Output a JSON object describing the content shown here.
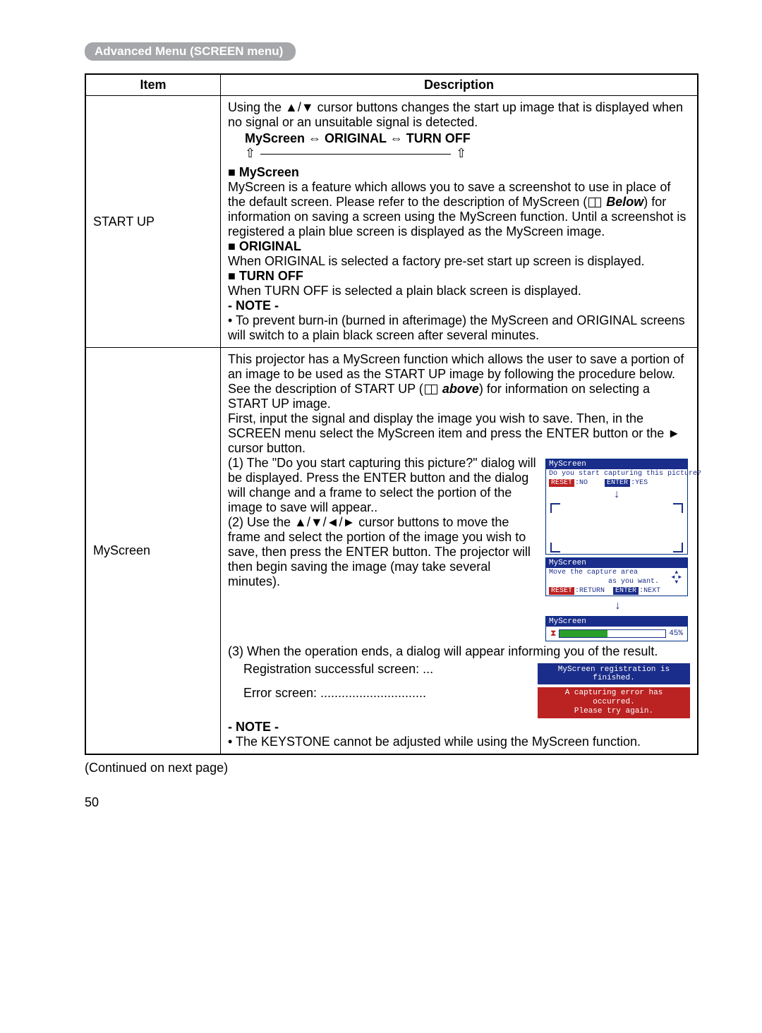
{
  "section_header": "Advanced Menu (SCREEN menu)",
  "table": {
    "header_item": "Item",
    "header_desc": "Description",
    "startup": {
      "item_label": "START UP",
      "intro": "Using the ▲/▼ cursor buttons changes the start up image that is displayed when no signal or an unsuitable signal is detected.",
      "cycle_text": "MyScreen ⇔ ORIGINAL ⇔ TURN OFF",
      "cycle_arrows_left": "⇧",
      "cycle_arrows_right": "⇧",
      "myscreen_head": "MyScreen",
      "myscreen_body_1": "MyScreen is a feature which allows you to save a screenshot to use in place of the default screen. Please refer to the description of MyScreen (",
      "below_ref": "Below",
      "myscreen_body_2": ") for information on saving a screen using the MyScreen function. Until a screenshot is registered a plain blue screen is displayed as the MyScreen image.",
      "original_head": "ORIGINAL",
      "original_body": "When ORIGINAL is selected a factory pre-set start up screen is displayed.",
      "turnoff_head": "TURN OFF",
      "turnoff_body": "When TURN OFF is selected a plain black screen is displayed.",
      "note_head": "- NOTE -",
      "note_body": "• To prevent burn-in (burned in afterimage) the MyScreen and ORIGINAL screens will switch to a plain black screen after several minutes."
    },
    "myscreen": {
      "item_label": "MyScreen",
      "intro_1": "This projector has a MyScreen function which allows the user to save a portion of an image to be used as the START UP image by following the procedure below. See the description of START UP (",
      "above_ref": "above",
      "intro_2": ") for information on selecting a START UP image.",
      "first": "First, input the signal and display the image you wish to save. Then, in the SCREEN menu select the MyScreen item and press the ENTER button or the ► cursor button.",
      "step1": "(1) The \"Do you start capturing this picture?\" dialog will be displayed. Press the ENTER button and the dialog will change and a frame to select the portion of the image to save will appear..",
      "step2": "(2) Use the ▲/▼/◄/► cursor buttons to move the frame and select the portion of the image you wish to save, then press the ENTER button. The projector will then begin saving the image (may take several minutes).",
      "step3": "(3) When the operation ends, a dialog will appear informing you of the result.",
      "reg_label": "Registration successful screen: ...",
      "err_label": "Error screen: ..............................",
      "note_head": "- NOTE -",
      "note_body": "• The KEYSTONE cannot be adjusted while using the MyScreen function.",
      "shot1": {
        "title": "MyScreen",
        "q": "Do you start capturing this picture?",
        "reset": "RESET",
        "reset_v": ":NO",
        "enter": "ENTER",
        "enter_v": ":YES"
      },
      "shot2": {
        "title": "MyScreen",
        "l1": "Move the capture area",
        "l2": "as you want.",
        "reset": "RESET",
        "reset_v": ":RETURN",
        "enter": "ENTER",
        "enter_v": ":NEXT"
      },
      "shot3": {
        "title": "MyScreen",
        "pct": "45%"
      },
      "shot_ok": "MyScreen registration is finished.",
      "shot_err1": "A capturing error has occurred.",
      "shot_err2": "Please try again."
    }
  },
  "continued": "(Continued on next page)",
  "page_number": "50"
}
